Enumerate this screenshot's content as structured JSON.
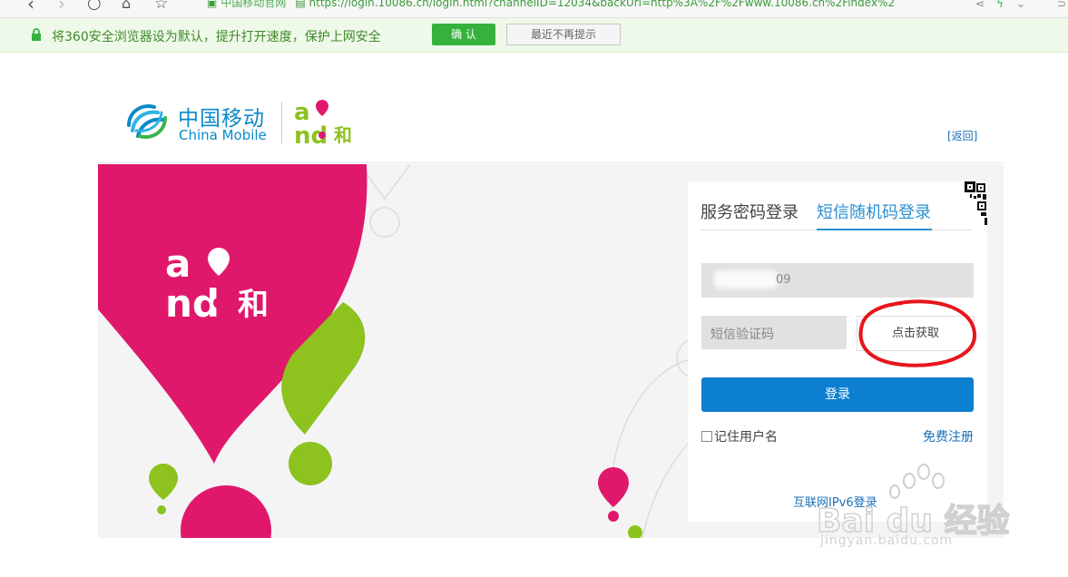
{
  "browser": {
    "site_name": "中国移动官网",
    "url": "https://login.10086.cn/login.html?channelID=12034&backUrl=http%3A%2F%2Fwww.10086.cn%2Findex%2"
  },
  "infobar": {
    "message": "将360安全浏览器设为默认，提升打开速度，保护上网安全",
    "confirm_label": "确 认",
    "dismiss_label": "最近不再提示"
  },
  "header": {
    "brand_cn": "中国移动",
    "brand_en": "China Mobile",
    "and_logo_text": "and和",
    "back_link": "[返回]"
  },
  "login": {
    "tabs": [
      {
        "label": "服务密码登录",
        "active": false
      },
      {
        "label": "短信随机码登录",
        "active": true
      }
    ],
    "phone_value_visible": "09",
    "sms_placeholder": "短信验证码",
    "get_code_label": "点击获取",
    "submit_label": "登录",
    "remember_label": "记住用户名",
    "register_label": "免费注册",
    "ipv6_label": "互联网IPv6登录"
  },
  "watermark": {
    "text": "Bai du 经验",
    "site": "jingyan.baidu.com"
  },
  "colors": {
    "brand_blue": "#0a89c9",
    "and_magenta": "#e0186c",
    "and_green": "#8dc21f",
    "primary_button": "#0d7fd0",
    "infobar_green": "#35b23e",
    "annotation_red": "#e8141c"
  }
}
